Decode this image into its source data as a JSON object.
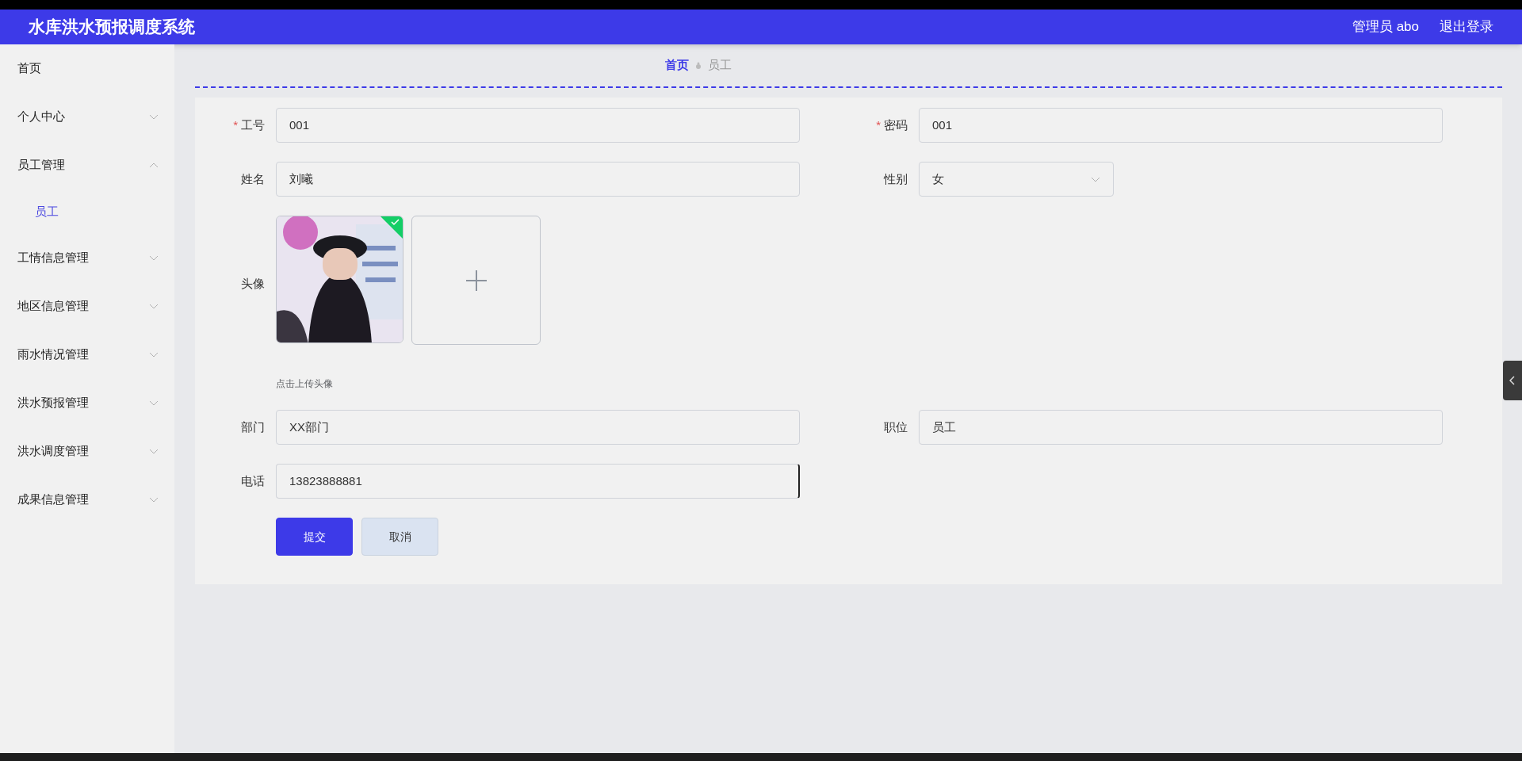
{
  "header": {
    "title": "水库洪水预报调度系统",
    "user": "管理员 abo",
    "logout": "退出登录"
  },
  "sidebar": {
    "items": [
      {
        "kind": "link",
        "label": "首页"
      },
      {
        "kind": "group",
        "label": "个人中心",
        "expanded": false
      },
      {
        "kind": "group",
        "label": "员工管理",
        "expanded": true,
        "children": [
          {
            "label": "员工",
            "selected": true
          }
        ]
      },
      {
        "kind": "group",
        "label": "工情信息管理",
        "expanded": false
      },
      {
        "kind": "group",
        "label": "地区信息管理",
        "expanded": false
      },
      {
        "kind": "group",
        "label": "雨水情况管理",
        "expanded": false
      },
      {
        "kind": "group",
        "label": "洪水预报管理",
        "expanded": false
      },
      {
        "kind": "group",
        "label": "洪水调度管理",
        "expanded": false
      },
      {
        "kind": "group",
        "label": "成果信息管理",
        "expanded": false
      }
    ]
  },
  "breadcrumb": [
    {
      "label": "首页",
      "selected": true
    },
    {
      "label": "员工",
      "selected": false
    }
  ],
  "form": {
    "rows": [
      [
        {
          "kind": "text",
          "label": "工号",
          "required_mark": "*",
          "value": "001"
        },
        {
          "kind": "text",
          "label": "密码",
          "required_mark": "*",
          "value": "001"
        }
      ],
      [
        {
          "kind": "text",
          "label": "姓名",
          "value": "刘曦"
        },
        {
          "kind": "select",
          "label": "性别",
          "value": "女"
        }
      ],
      [
        {
          "kind": "upload",
          "label": "头像",
          "uploaded": true,
          "hint": "点击上传头像"
        }
      ],
      [
        {
          "kind": "text",
          "label": "部门",
          "value": "XX部门"
        },
        {
          "kind": "text",
          "label": "职位",
          "value": "员工"
        }
      ],
      [
        {
          "kind": "text",
          "label": "电话",
          "value": "13823888881",
          "focused": true
        }
      ]
    ],
    "buttons": [
      {
        "kind": "primary",
        "label": "提交"
      },
      {
        "kind": "default",
        "label": "取消"
      }
    ]
  }
}
